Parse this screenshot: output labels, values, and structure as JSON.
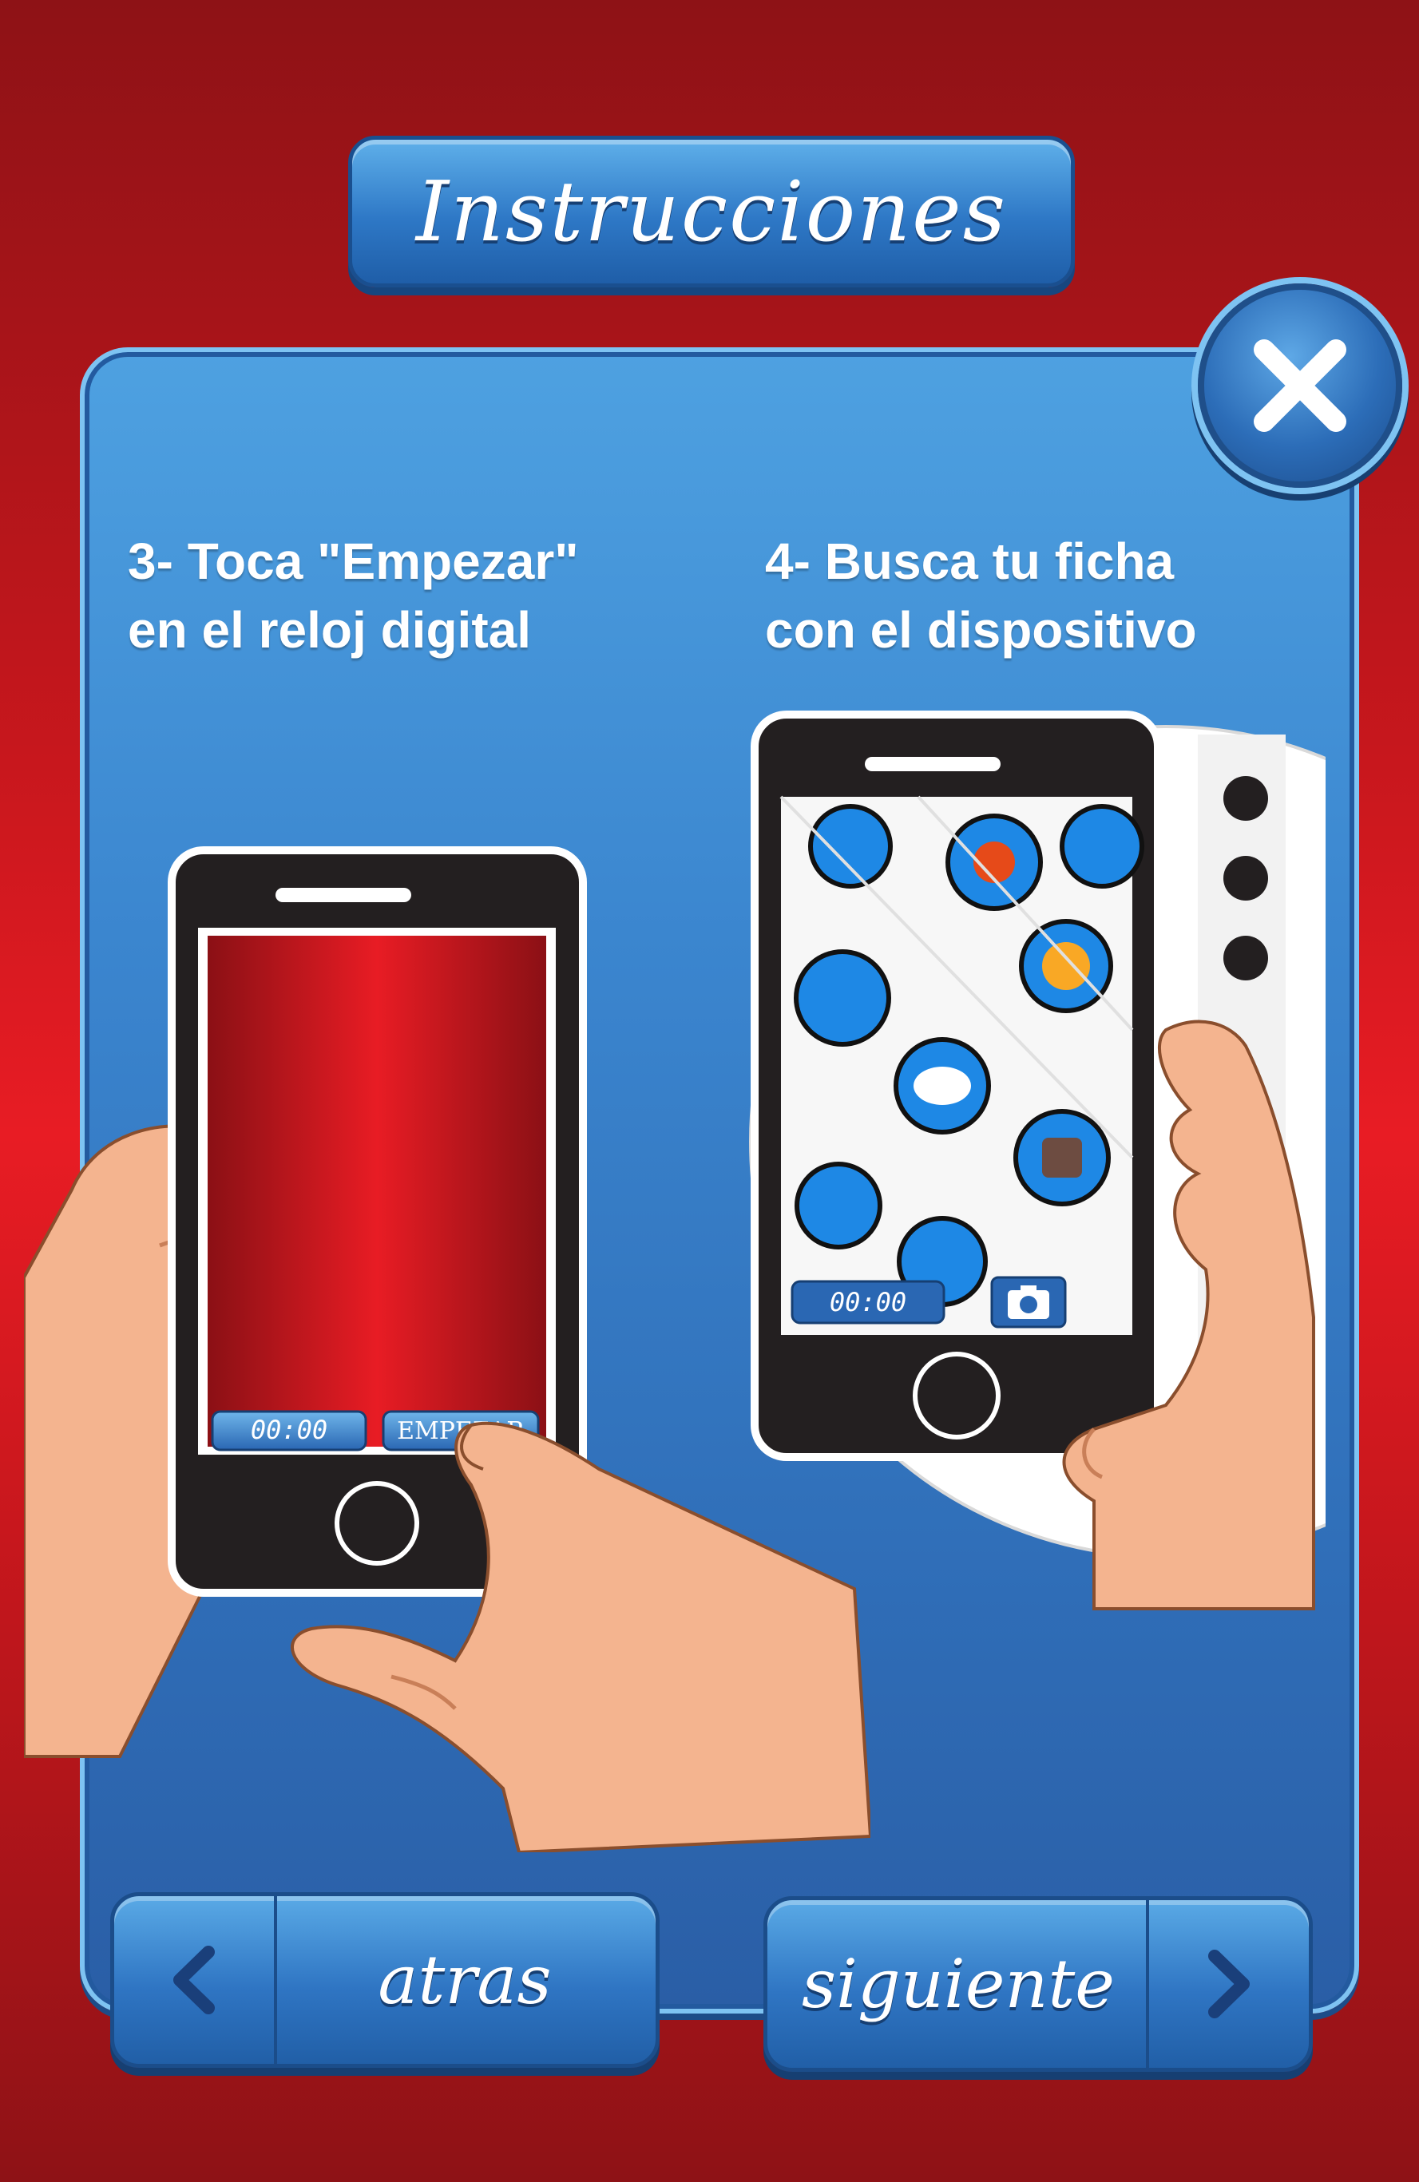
{
  "header": {
    "title": "Instrucciones"
  },
  "steps": [
    {
      "line1": "3- Toca \"Empezar\"",
      "line2": "en el reloj digital"
    },
    {
      "line1": "4- Busca tu ficha",
      "line2": "con el dispositivo"
    }
  ],
  "phone_left": {
    "timer": "00:00",
    "button": "EMPEZAR"
  },
  "phone_right": {
    "timer": "00:00"
  },
  "nav": {
    "back_label": "atras",
    "next_label": "siguiente"
  },
  "colors": {
    "background": "#e81c24",
    "panel": "#3b86cf",
    "button": "#2f75c3"
  },
  "icons": [
    "close-icon",
    "camera-icon",
    "chevron-left-icon",
    "chevron-right-icon"
  ]
}
